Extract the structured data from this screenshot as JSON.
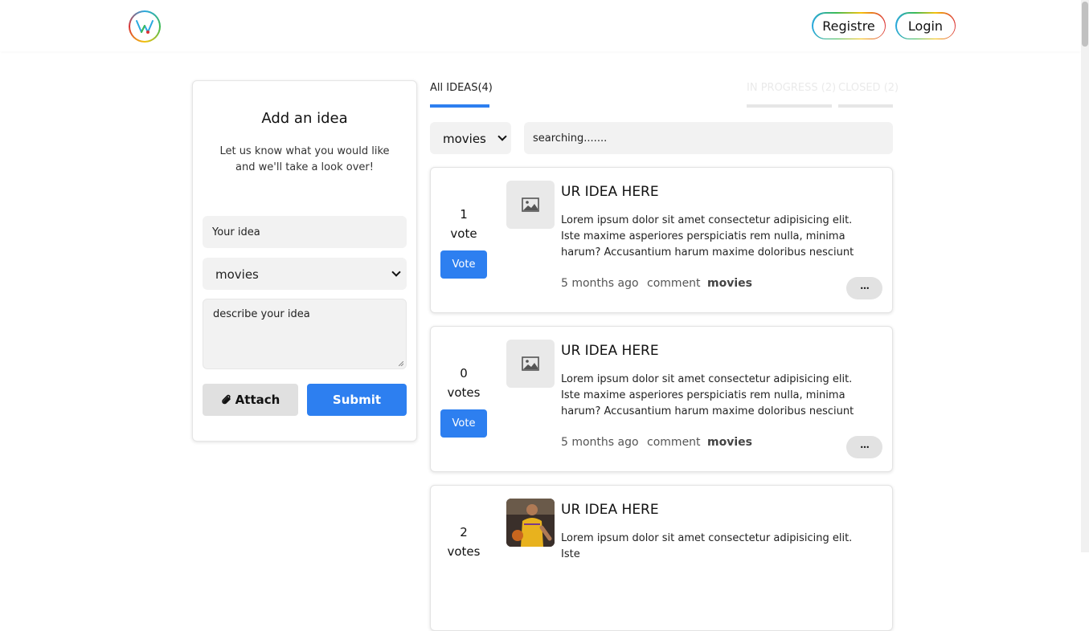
{
  "header": {
    "register_label": "Registre",
    "login_label": "Login"
  },
  "add_idea": {
    "title": "Add an idea",
    "description": "Let us know what you would like and we'll take a look over!",
    "idea_value": "Your idea",
    "category_value": "movies",
    "describe_value": "describe your idea",
    "attach_label": "Attach",
    "submit_label": "Submit"
  },
  "tabs": {
    "all": "All IDEAS(4)",
    "in_progress": "IN PROGRESS (2)",
    "closed": "CLOSED (2)"
  },
  "filter": {
    "category_value": "movies",
    "search_value": "searching......."
  },
  "ideas": [
    {
      "votes_count": "1",
      "votes_word": "vote",
      "vote_label": "Vote",
      "title": "UR IDEA HERE",
      "body": "Lorem ipsum dolor sit amet consectetur adipisicing elit. Iste maxime asperiores perspiciatis rem nulla, minima harum? Accusantium harum maxime doloribus nesciunt tempora,",
      "time": "5 months ago",
      "comment": "comment",
      "category": "movies",
      "more": "•••"
    },
    {
      "votes_count": "0",
      "votes_word": "votes",
      "vote_label": "Vote",
      "title": "UR IDEA HERE",
      "body": "Lorem ipsum dolor sit amet consectetur adipisicing elit. Iste maxime asperiores perspiciatis rem nulla, minima harum? Accusantium harum maxime doloribus nesciunt tempora,...",
      "time": "5 months ago",
      "comment": "comment",
      "category": "movies",
      "more": "•••"
    },
    {
      "votes_count": "2",
      "votes_word": "votes",
      "title": "UR IDEA HERE",
      "body": "Lorem ipsum dolor sit amet consectetur adipisicing elit. Iste"
    }
  ]
}
